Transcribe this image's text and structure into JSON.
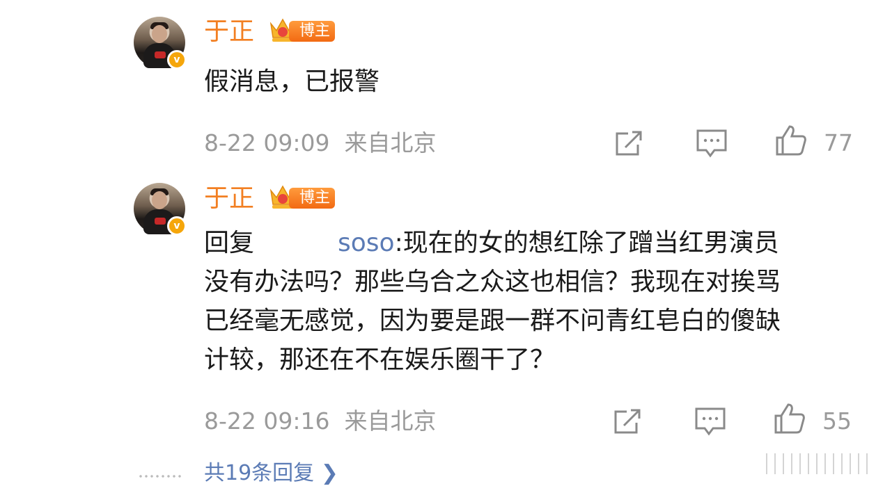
{
  "comments": [
    {
      "author": "于正",
      "badge": "博主",
      "verified_mark": "v",
      "text": "假消息，已报警",
      "time": "8-22 09:09",
      "location": "来自北京",
      "likes": "77"
    },
    {
      "author": "于正",
      "badge": "博主",
      "verified_mark": "v",
      "reply_prefix": "回复",
      "reply_to": "soso",
      "text_line1": ":现在的女的想红除了蹭当红男演员",
      "text_line2": "没有办法吗？那些乌合之众这也相信？我现在对挨骂",
      "text_line3": "已经毫无感觉，因为要是跟一群不问青红皂白的傻缺",
      "text_line4": "计较，那还在不在娱乐圈干了？",
      "time": "8-22 09:16",
      "location": "来自北京",
      "likes": "55"
    }
  ],
  "more_replies": "共19条回复 ❯",
  "colors": {
    "name": "#f27f22",
    "meta": "#9a9a9a",
    "link": "#5b7bb5",
    "badge": "#f26a12"
  },
  "icons": [
    "share-icon",
    "comment-icon",
    "like-icon",
    "crown-icon",
    "verified-icon"
  ]
}
